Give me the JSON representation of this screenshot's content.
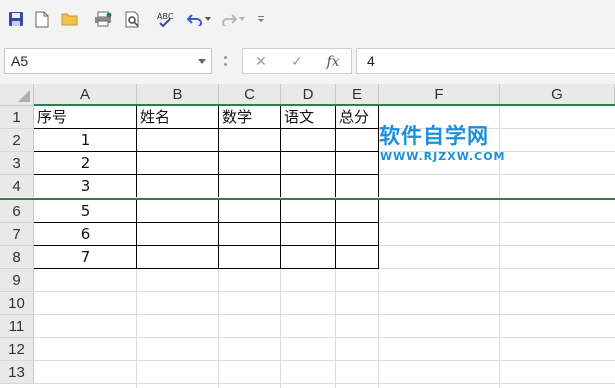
{
  "toolbar": {
    "icons": [
      "save-icon",
      "new-document-icon",
      "open-folder-icon",
      "print-icon",
      "print-preview-icon",
      "spell-check-icon",
      "undo-icon",
      "redo-icon",
      "customize-toolbar-icon"
    ]
  },
  "formula_bar": {
    "name_box": "A5",
    "cancel_symbol": "✕",
    "enter_symbol": "✓",
    "fx_label": "fx",
    "formula_value": "4"
  },
  "grid": {
    "columns": [
      "A",
      "B",
      "C",
      "D",
      "E",
      "F",
      "G"
    ],
    "rows": [
      "1",
      "2",
      "3",
      "4",
      "6",
      "7",
      "8",
      "9",
      "10",
      "11",
      "12",
      "13"
    ],
    "cells": {
      "a1": "序号",
      "b1": "姓名",
      "c1": "数学",
      "d1": "语文",
      "e1": "总分",
      "a2": "1",
      "a3": "2",
      "a4": "3",
      "a6": "5",
      "a7": "6",
      "a8": "7"
    }
  },
  "watermark": {
    "title": "软件自学网",
    "url": "WWW.RJZXW.COM"
  },
  "colors": {
    "accent_green": "#2e7d4f",
    "watermark_blue": "#1d8fd8"
  }
}
